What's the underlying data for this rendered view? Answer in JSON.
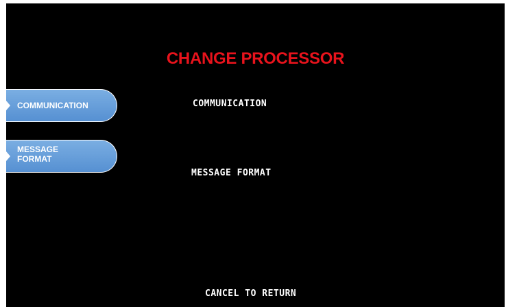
{
  "screen": {
    "title": "CHANGE PROCESSOR",
    "title_color": "#e8131c",
    "background_color": "#000000"
  },
  "function_keys": [
    {
      "label": "COMMUNICATION"
    },
    {
      "label": "MESSAGE FORMAT"
    }
  ],
  "options": [
    {
      "text": "COMMUNICATION"
    },
    {
      "text": "MESSAGE FORMAT"
    }
  ],
  "footer": {
    "text": "CANCEL TO RETURN"
  },
  "colors": {
    "key_fill": "#6aa0dc",
    "key_text": "#ffffff"
  }
}
